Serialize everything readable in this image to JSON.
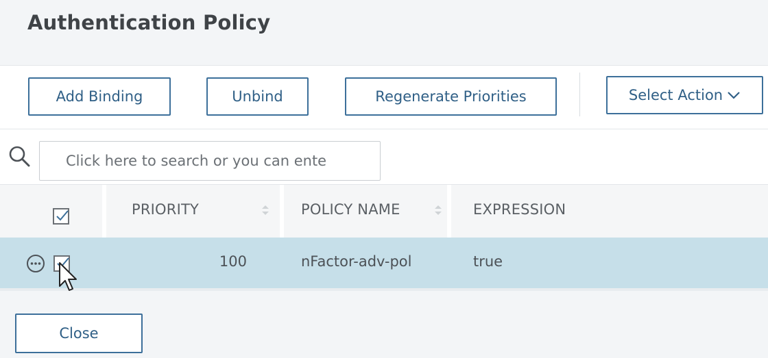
{
  "header": {
    "title": "Authentication Policy"
  },
  "toolbar": {
    "add_binding": "Add Binding",
    "unbind": "Unbind",
    "regenerate": "Regenerate Priorities",
    "select_action": "Select Action"
  },
  "search": {
    "placeholder": "Click here to search or you can ente"
  },
  "table": {
    "columns": [
      "PRIORITY",
      "POLICY NAME",
      "EXPRESSION"
    ],
    "header_checked": true,
    "rows": [
      {
        "priority": "100",
        "policy_name": "nFactor-adv-pol",
        "expression": "true",
        "checked": true,
        "selected": true
      }
    ]
  },
  "footer": {
    "close": "Close"
  },
  "colors": {
    "accent": "#3c6f9a",
    "selected_row": "#c6dfe9",
    "header_bg": "#f3f5f7"
  },
  "icons": [
    "search-icon",
    "chevron-down-icon",
    "sort-icon",
    "checkbox-icon",
    "more-options-icon",
    "mouse-cursor-icon"
  ]
}
